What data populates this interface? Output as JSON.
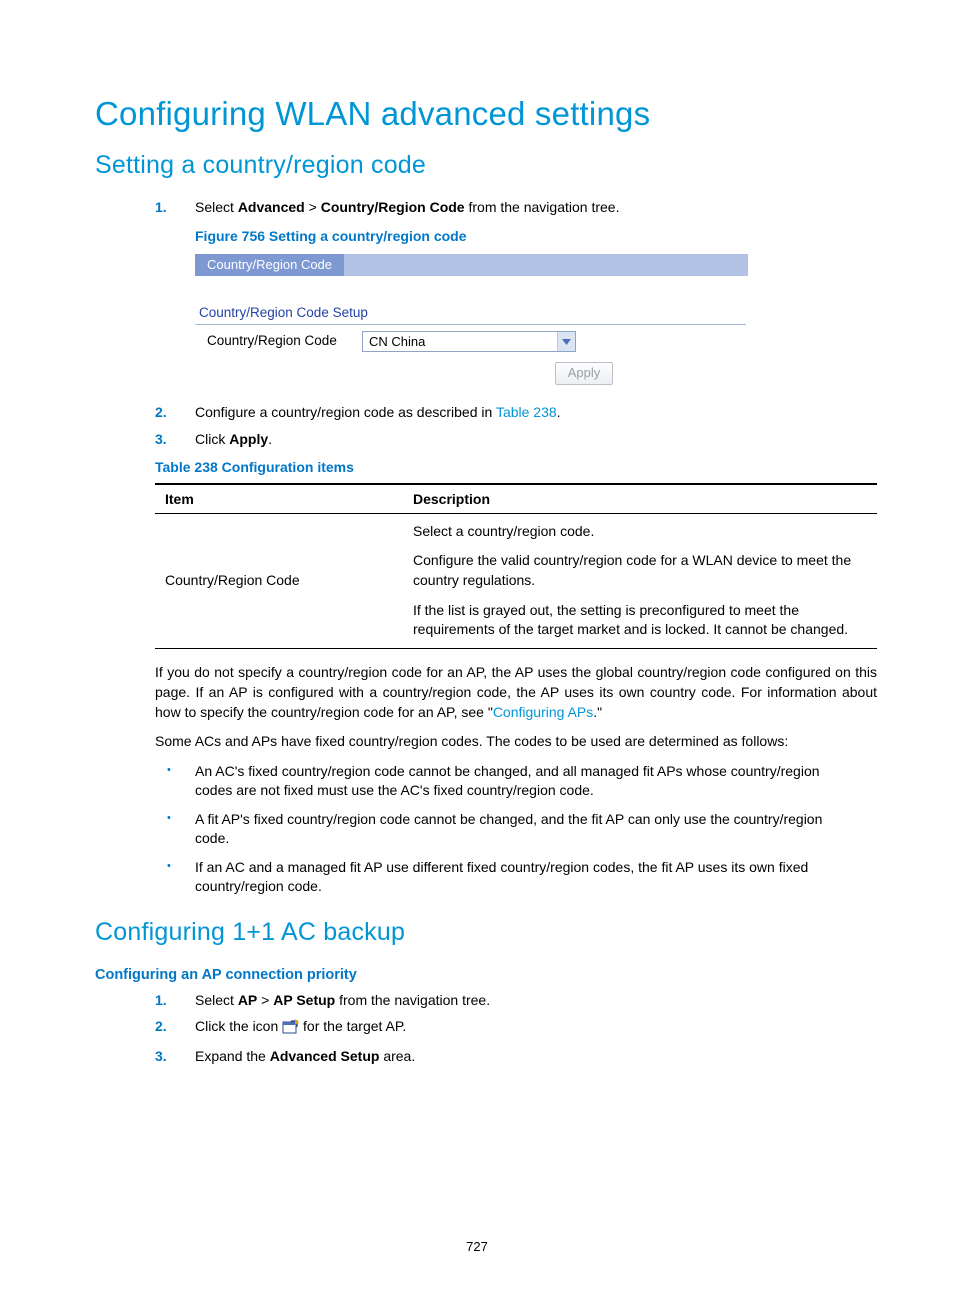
{
  "h1": "Configuring WLAN advanced settings",
  "h2a": "Setting a country/region code",
  "steps_a": {
    "n1": "1.",
    "t1_pre": "Select ",
    "t1_b1": "Advanced",
    "t1_mid": " > ",
    "t1_b2": "Country/Region Code",
    "t1_post": " from the navigation tree.",
    "fig_caption": "Figure 756 Setting a country/region code",
    "n2": "2.",
    "t2_pre": "Configure a country/region code as described in ",
    "t2_link": "Table 238",
    "t2_post": ".",
    "n3": "3.",
    "t3_pre": "Click ",
    "t3_b": "Apply",
    "t3_post": "."
  },
  "figure": {
    "tab_label": "Country/Region Code",
    "setup_title": "Country/Region Code Setup",
    "row_label": "Country/Region Code",
    "dropdown_value": "CN China",
    "apply_label": "Apply"
  },
  "table_caption": "Table 238 Configuration items",
  "table": {
    "h1": "Item",
    "h2": "Description",
    "r1_item": "Country/Region Code",
    "r1_p1": "Select a country/region code.",
    "r1_p2": "Configure the valid country/region code for a WLAN device to meet the country regulations.",
    "r1_p3": "If the list is grayed out, the setting is preconfigured to meet the requirements of the target market and is locked. It cannot be changed."
  },
  "para1_pre": "If you do not specify a country/region code for an AP, the AP uses the global country/region code configured on this page. If an AP is configured with a country/region code, the AP uses its own country code. For information about how to specify the country/region code for an AP, see \"",
  "para1_link": "Configuring APs",
  "para1_post": ".\"",
  "para2": "Some ACs and APs have fixed country/region codes. The codes to be used are determined as follows:",
  "bul1": "An AC's fixed country/region code cannot be changed, and all managed fit APs whose country/region codes are not fixed must use the AC's fixed country/region code.",
  "bul2": "A fit AP's fixed country/region code cannot be changed, and the fit AP can only use the country/region code.",
  "bul3": "If an AC and a managed fit AP use different fixed country/region codes, the fit AP uses its own fixed country/region code.",
  "h2b": "Configuring 1+1 AC backup",
  "h3b": "Configuring an AP connection priority",
  "steps_b": {
    "n1": "1.",
    "t1_pre": "Select ",
    "t1_b1": "AP",
    "t1_mid": " > ",
    "t1_b2": "AP Setup",
    "t1_post": " from the navigation tree.",
    "n2": "2.",
    "t2_pre": "Click the icon ",
    "t2_post": " for the target AP.",
    "n3": "3.",
    "t3_pre": "Expand the ",
    "t3_b": "Advanced Setup",
    "t3_post": " area."
  },
  "page_number": "727"
}
